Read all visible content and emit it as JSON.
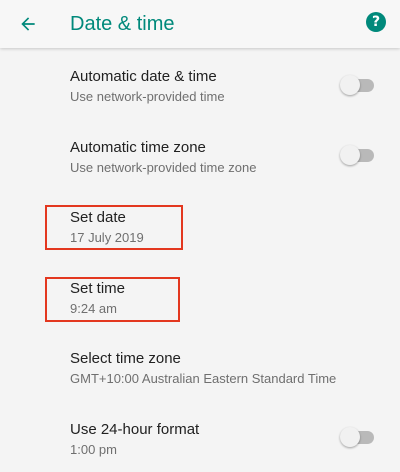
{
  "app_bar": {
    "title": "Date & time",
    "back_icon": "arrow-back-icon",
    "help_icon": "help-icon",
    "help_glyph": "?",
    "accent_color": "#00897b"
  },
  "preferences": [
    {
      "title": "Automatic date & time",
      "summary": "Use network-provided time",
      "switch": "off"
    },
    {
      "title": "Automatic time zone",
      "summary": "Use network-provided time zone",
      "switch": "off"
    },
    {
      "title": "Set date",
      "summary": "17 July 2019"
    },
    {
      "title": "Set time",
      "summary": "9:24 am"
    },
    {
      "title": "Select time zone",
      "summary": "GMT+10:00 Australian Eastern Standard Time"
    },
    {
      "title": "Use 24-hour format",
      "summary": "1:00 pm",
      "switch": "off"
    }
  ],
  "highlight_color": "#e3371f"
}
